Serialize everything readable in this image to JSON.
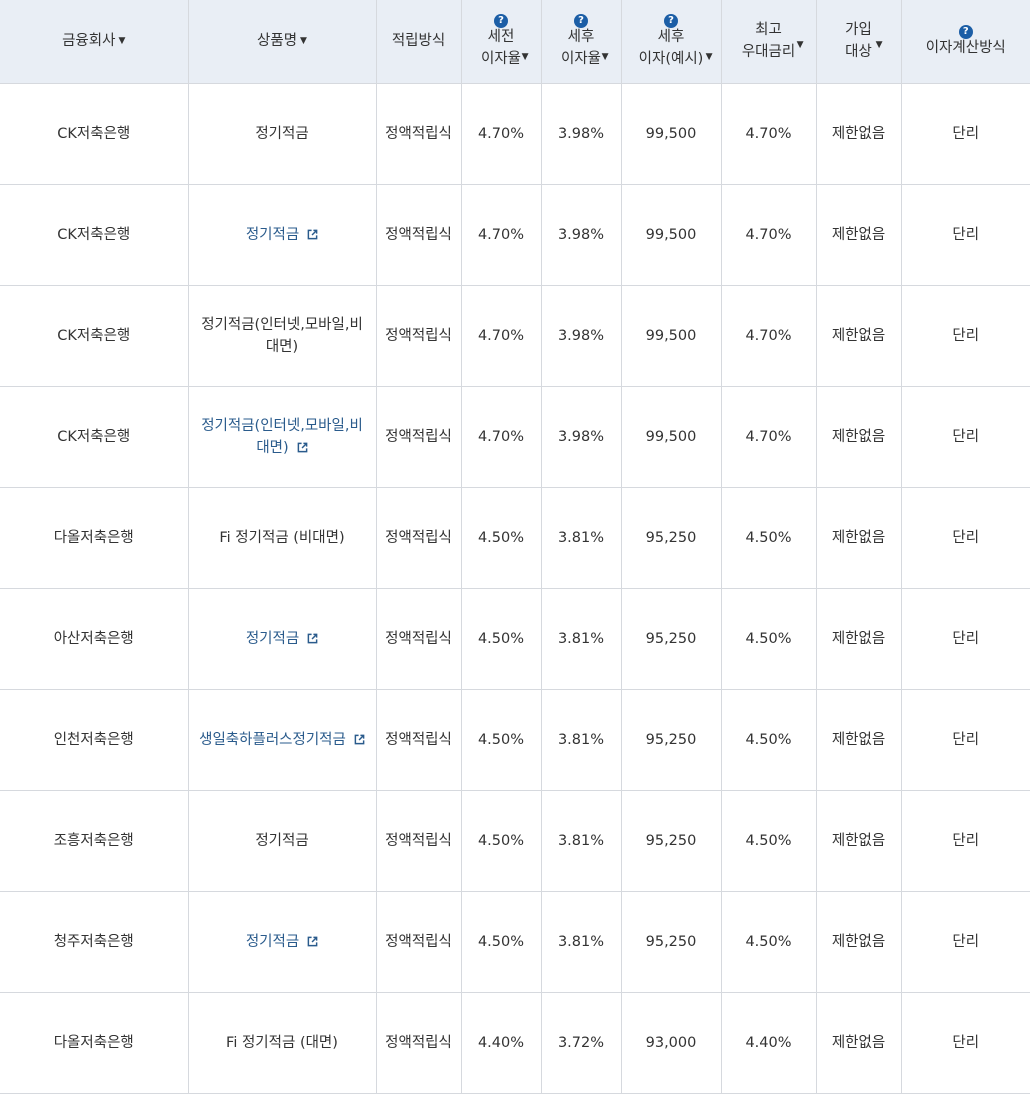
{
  "headers": {
    "company": "금융회사",
    "product": "상품명",
    "method": "적립방식",
    "pretax_l1": "세전",
    "pretax_l2": "이자율",
    "aftertax_l1": "세후",
    "aftertax_l2": "이자율",
    "interest_l1": "세후",
    "interest_l2": "이자(예시)",
    "max_l1": "최고",
    "max_l2": "우대금리",
    "target_l1": "가입",
    "target_l2": "대상",
    "calc": "이자계산방식",
    "help_glyph": "?",
    "sort_glyph": "▼"
  },
  "colors": {
    "header_bg": "#e9eef5",
    "link": "#2a5b8c",
    "help_icon": "#1c5ea6",
    "border": "#d6d9de"
  },
  "rows": [
    {
      "company": "CK저축은행",
      "product_l1": "정기적금",
      "product_l2": "",
      "method": "정액적립식",
      "pretax": "4.70%",
      "aftertax": "3.98%",
      "interest": "99,500",
      "max": "4.70%",
      "target": "제한없음",
      "calc": "단리"
    },
    {
      "company": "CK저축은행",
      "product_l1": "정기적금",
      "product_l2": "",
      "method": "정액적립식",
      "pretax": "4.70%",
      "aftertax": "3.98%",
      "interest": "99,500",
      "max": "4.70%",
      "target": "제한없음",
      "calc": "단리"
    },
    {
      "company": "CK저축은행",
      "product_l1": "정기적금(인터넷,모바일,비",
      "product_l2": "대면)",
      "method": "정액적립식",
      "pretax": "4.70%",
      "aftertax": "3.98%",
      "interest": "99,500",
      "max": "4.70%",
      "target": "제한없음",
      "calc": "단리"
    },
    {
      "company": "CK저축은행",
      "product_l1": "정기적금(인터넷,모바일,비",
      "product_l2": "대면)",
      "method": "정액적립식",
      "pretax": "4.70%",
      "aftertax": "3.98%",
      "interest": "99,500",
      "max": "4.70%",
      "target": "제한없음",
      "calc": "단리"
    },
    {
      "company": "다올저축은행",
      "product_l1": "Fi 정기적금 (비대면)",
      "product_l2": "",
      "method": "정액적립식",
      "pretax": "4.50%",
      "aftertax": "3.81%",
      "interest": "95,250",
      "max": "4.50%",
      "target": "제한없음",
      "calc": "단리"
    },
    {
      "company": "아산저축은행",
      "product_l1": "정기적금",
      "product_l2": "",
      "method": "정액적립식",
      "pretax": "4.50%",
      "aftertax": "3.81%",
      "interest": "95,250",
      "max": "4.50%",
      "target": "제한없음",
      "calc": "단리"
    },
    {
      "company": "인천저축은행",
      "product_l1": "생일축하플러스정기적금",
      "product_l2": "",
      "method": "정액적립식",
      "pretax": "4.50%",
      "aftertax": "3.81%",
      "interest": "95,250",
      "max": "4.50%",
      "target": "제한없음",
      "calc": "단리"
    },
    {
      "company": "조흥저축은행",
      "product_l1": "정기적금",
      "product_l2": "",
      "method": "정액적립식",
      "pretax": "4.50%",
      "aftertax": "3.81%",
      "interest": "95,250",
      "max": "4.50%",
      "target": "제한없음",
      "calc": "단리"
    },
    {
      "company": "청주저축은행",
      "product_l1": "정기적금",
      "product_l2": "",
      "method": "정액적립식",
      "pretax": "4.50%",
      "aftertax": "3.81%",
      "interest": "95,250",
      "max": "4.50%",
      "target": "제한없음",
      "calc": "단리"
    },
    {
      "company": "다올저축은행",
      "product_l1": "Fi 정기적금 (대면)",
      "product_l2": "",
      "method": "정액적립식",
      "pretax": "4.40%",
      "aftertax": "3.72%",
      "interest": "93,000",
      "max": "4.40%",
      "target": "제한없음",
      "calc": "단리"
    }
  ]
}
